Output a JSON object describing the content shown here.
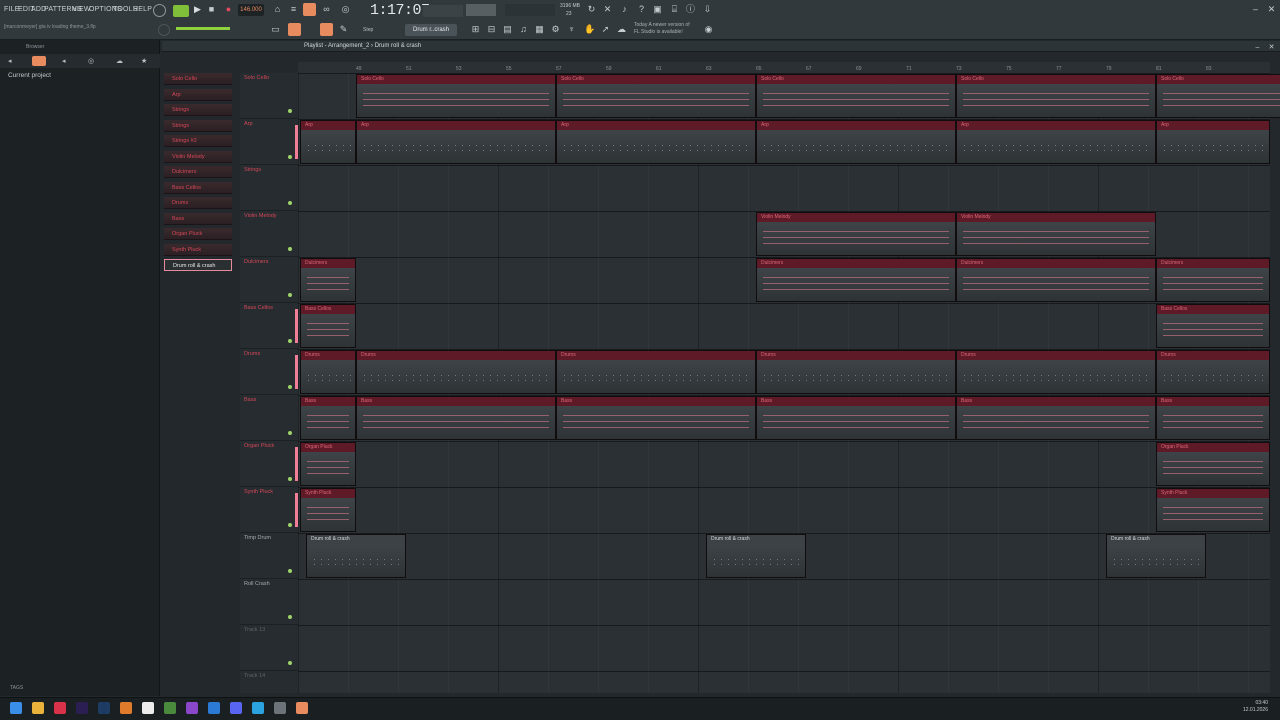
{
  "menu": [
    "FILE",
    "EDIT",
    "ADD",
    "PATTERNS",
    "VIEW",
    "OPTIONS",
    "TOOLS",
    "HELP"
  ],
  "project_file": "[marconmeyer] gta iv loading theme_3.flp",
  "tempo": "146.000",
  "song_time": "1:17:07",
  "pattern_name": "Drum r..crash",
  "step_label": "Step",
  "news": [
    "Today  A newer version of",
    "FL Studio is available!"
  ],
  "cpu": [
    "3196 MB",
    "23"
  ],
  "browser": {
    "title": "Browser",
    "current_project": "Current project",
    "tags_label": "TAGS"
  },
  "playlist": {
    "title": "Playlist - Arrangement_2",
    "breadcrumb": "Drum roll & crash"
  },
  "ruler": [
    "49",
    "51",
    "53",
    "55",
    "57",
    "59",
    "61",
    "63",
    "65",
    "67",
    "69",
    "71",
    "73",
    "75",
    "77",
    "79",
    "81",
    "83"
  ],
  "picker": [
    "Solo Cello",
    "Arp",
    "Strings",
    "Strings",
    "Strings #2",
    "Violin Melody",
    "Dulcimers",
    "Bass Cellos",
    "Drums",
    "Bass",
    "Organ Pluck",
    "Synth Pluck",
    "Drum roll & crash"
  ],
  "tracks": [
    "Solo Cello",
    "Arp",
    "Strings",
    "Violin Melody",
    "Dulcimers",
    "Bass Cellos",
    "Drums",
    "Bass",
    "Organ Pluck",
    "Synth Pluck",
    "Timp Drum",
    "Roll Crash",
    "Track 13",
    "Track 14"
  ],
  "clips": {
    "solo_cello": "Solo Cello",
    "arp": "Arp",
    "violin": "Violin Melody",
    "dulcimers": "Dulcimers",
    "bass_cellos": "Bass Cellos",
    "drums": "Drums",
    "bass": "Bass",
    "organ": "Organ Pluck",
    "synth": "Synth Pluck",
    "roll": "Drum roll & crash"
  },
  "clock": [
    "03:40",
    "12.01.2026"
  ],
  "colors": {
    "accent": "#d84759",
    "pink": "#ef7e96",
    "green": "#9fd36a"
  }
}
